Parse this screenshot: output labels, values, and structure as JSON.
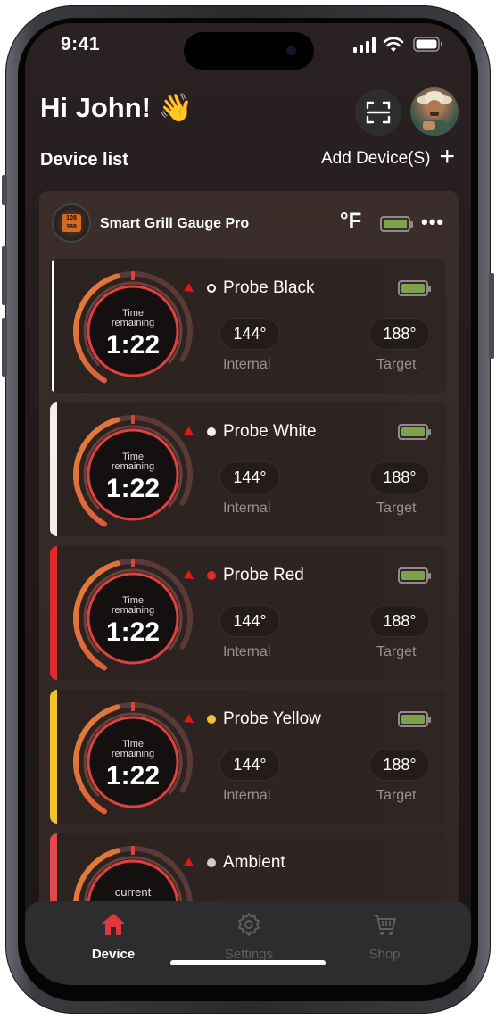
{
  "status_bar": {
    "time": "9:41"
  },
  "header": {
    "greeting": "Hi John! 👋",
    "scan_icon": "scan-frame-icon",
    "avatar": "user-avatar"
  },
  "device_list": {
    "title": "Device list",
    "add_label": "Add Device(S)",
    "add_icon": "plus-icon"
  },
  "device": {
    "name": "Smart Grill Gauge Pro",
    "unit": "°F",
    "battery_level": 1.0,
    "thumb_text": "108 388",
    "more_icon": "more-dots-icon",
    "probes": [
      {
        "name": "Probe Black",
        "color": "#ffffff",
        "dot": "hollow",
        "gauge_top": "Time",
        "gauge_mid": "remaining",
        "gauge_value": "1:22",
        "internal": "144°",
        "internal_label": "Internal",
        "target": "188°",
        "target_label": "Target",
        "battery_level": 1.0
      },
      {
        "name": "Probe White",
        "color": "#f4eeee",
        "dot": "solid",
        "gauge_top": "Time",
        "gauge_mid": "remaining",
        "gauge_value": "1:22",
        "internal": "144°",
        "internal_label": "Internal",
        "target": "188°",
        "target_label": "Target",
        "battery_level": 1.0
      },
      {
        "name": "Probe Red",
        "color": "#e12a2a",
        "dot": "solid",
        "gauge_top": "Time",
        "gauge_mid": "remaining",
        "gauge_value": "1:22",
        "internal": "144°",
        "internal_label": "Internal",
        "target": "188°",
        "target_label": "Target",
        "battery_level": 1.0
      },
      {
        "name": "Probe Yellow",
        "color": "#f2c12e",
        "dot": "solid",
        "gauge_top": "Time",
        "gauge_mid": "remaining",
        "gauge_value": "1:22",
        "internal": "144°",
        "internal_label": "Internal",
        "target": "188°",
        "target_label": "Target",
        "battery_level": 1.0
      },
      {
        "name": "Ambient",
        "color": "#e04a4a",
        "dot": "solid-light",
        "gauge_top": "current",
        "gauge_mid": "",
        "gauge_value": "",
        "internal": "",
        "internal_label": "",
        "target": "",
        "target_label": "",
        "battery_level": null
      }
    ]
  },
  "tabs": [
    {
      "label": "Device",
      "icon": "home-icon",
      "active": true
    },
    {
      "label": "Settings",
      "icon": "gear-icon",
      "active": false
    },
    {
      "label": "Shop",
      "icon": "cart-icon",
      "active": false
    }
  ],
  "colors": {
    "accent": "#e0383a",
    "gauge_arc_warm": "#e07a3a",
    "battery": "#7fa34a"
  }
}
